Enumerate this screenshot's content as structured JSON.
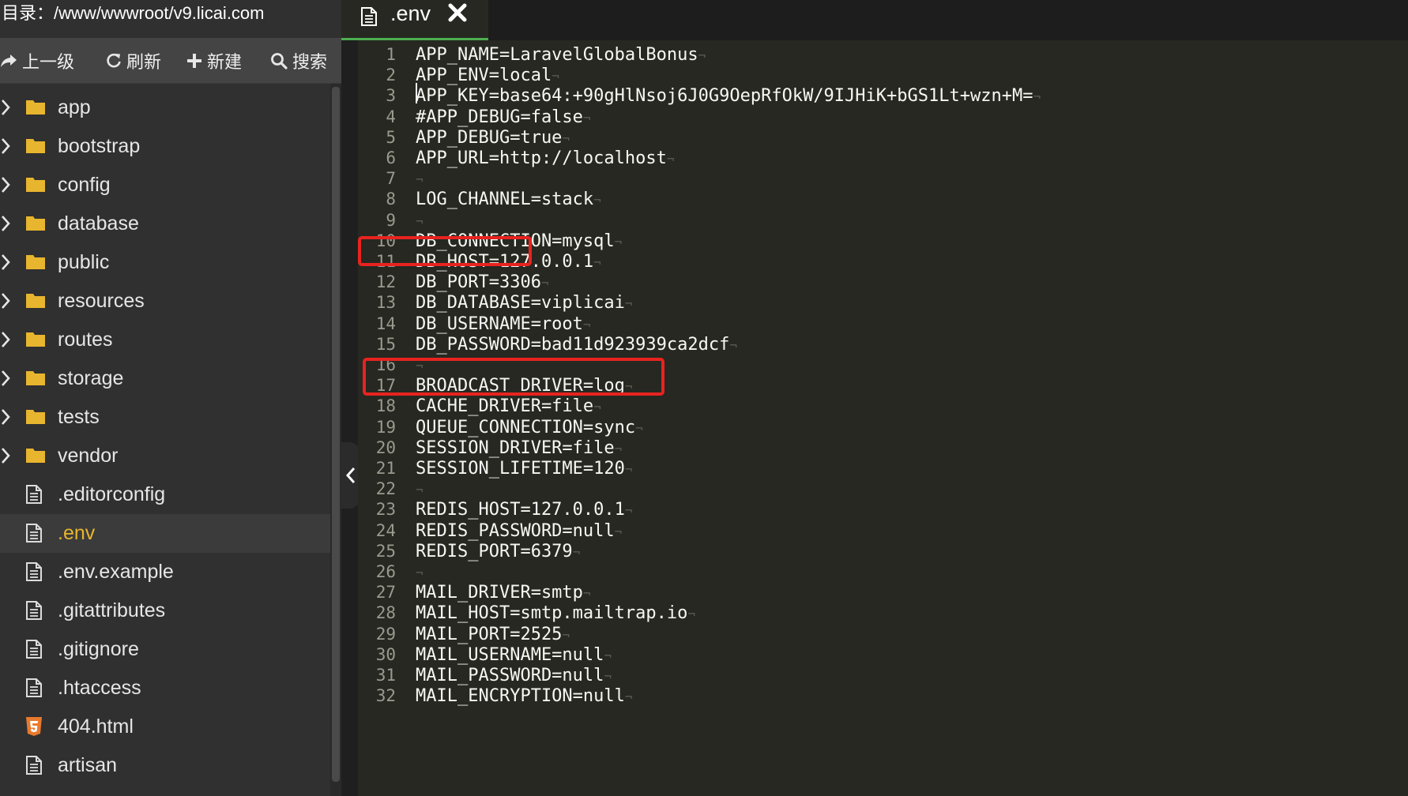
{
  "sidebar": {
    "path_label": "目录：/www/wwwroot/v9.licai.com",
    "toolbar": {
      "up": "上一级",
      "refresh": "刷新",
      "new": "新建",
      "search": "搜索"
    },
    "items": [
      {
        "name": "app",
        "type": "folder"
      },
      {
        "name": "bootstrap",
        "type": "folder"
      },
      {
        "name": "config",
        "type": "folder"
      },
      {
        "name": "database",
        "type": "folder"
      },
      {
        "name": "public",
        "type": "folder"
      },
      {
        "name": "resources",
        "type": "folder"
      },
      {
        "name": "routes",
        "type": "folder"
      },
      {
        "name": "storage",
        "type": "folder"
      },
      {
        "name": "tests",
        "type": "folder"
      },
      {
        "name": "vendor",
        "type": "folder"
      },
      {
        "name": ".editorconfig",
        "type": "file"
      },
      {
        "name": ".env",
        "type": "file",
        "active": true
      },
      {
        "name": ".env.example",
        "type": "file"
      },
      {
        "name": ".gitattributes",
        "type": "file"
      },
      {
        "name": ".gitignore",
        "type": "file"
      },
      {
        "name": ".htaccess",
        "type": "file"
      },
      {
        "name": "404.html",
        "type": "html"
      },
      {
        "name": "artisan",
        "type": "file"
      }
    ]
  },
  "editor": {
    "tab": {
      "label": ".env",
      "icon": "document-icon",
      "close_icon": "close-icon"
    },
    "lines": [
      "APP_NAME=LaravelGlobalBonus",
      "APP_ENV=local",
      "APP_KEY=base64:+90gHlNsoj6J0G9OepRfOkW/9IJHiK+bGS1Lt+wzn+M=",
      "#APP_DEBUG=false",
      "APP_DEBUG=true",
      "APP_URL=http://localhost",
      "",
      "LOG_CHANNEL=stack",
      "",
      "DB_CONNECTION=mysql",
      "DB_HOST=127.0.0.1",
      "DB_PORT=3306",
      "DB_DATABASE=viplicai",
      "DB_USERNAME=root",
      "DB_PASSWORD=bad11d923939ca2dcf",
      "",
      "BROADCAST_DRIVER=log",
      "CACHE_DRIVER=file",
      "QUEUE_CONNECTION=sync",
      "SESSION_DRIVER=file",
      "SESSION_LIFETIME=120",
      "",
      "REDIS_HOST=127.0.0.1",
      "REDIS_PASSWORD=null",
      "REDIS_PORT=6379",
      "",
      "MAIL_DRIVER=smtp",
      "MAIL_HOST=smtp.mailtrap.io",
      "MAIL_PORT=2525",
      "MAIL_USERNAME=null",
      "MAIL_PASSWORD=null",
      "MAIL_ENCRYPTION=null"
    ],
    "eol_marker": "¬",
    "highlighted_lines": [
      11,
      15
    ]
  },
  "colors": {
    "accent_tab": "#4caf50",
    "folder": "#e8b52e",
    "active_file": "#e8b52e",
    "highlight_box": "#e8231f",
    "html_icon": "#e87a2e"
  }
}
